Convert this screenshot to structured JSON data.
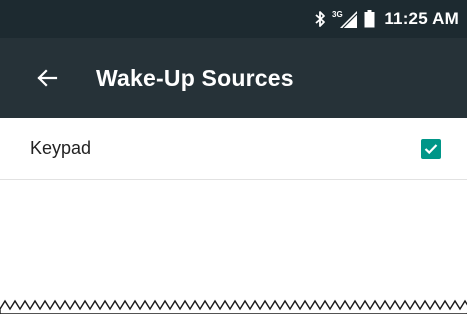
{
  "status_bar": {
    "time": "11:25 AM",
    "icons": [
      "bluetooth-icon",
      "signal-3g-icon",
      "battery-icon"
    ],
    "network_label": "3G",
    "bg_color": "#1d2a30"
  },
  "app_bar": {
    "title": "Wake-Up Sources",
    "back_icon": "arrow-back-icon",
    "bg_color": "#263238"
  },
  "list": {
    "items": [
      {
        "label": "Keypad",
        "checked": true
      }
    ]
  },
  "colors": {
    "accent": "#009688",
    "divider": "#e2e2e2"
  }
}
